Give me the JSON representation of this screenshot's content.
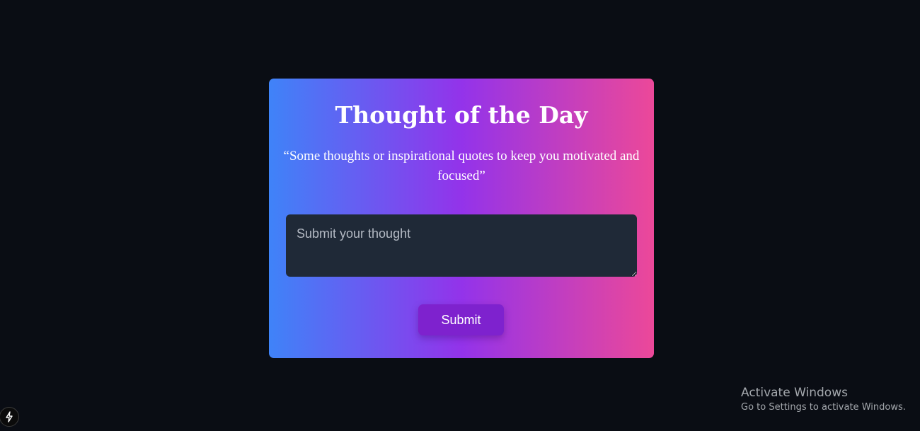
{
  "card": {
    "title": "Thought of the Day",
    "quote": "“Some thoughts or inspirational quotes to keep you motivated and focused”",
    "input": {
      "placeholder": "Submit your thought",
      "value": ""
    },
    "submit_label": "Submit"
  },
  "watermark": {
    "title": "Activate Windows",
    "subtitle": "Go to Settings to activate Windows."
  },
  "dev_badge": {
    "icon": "lightning-icon"
  },
  "colors": {
    "background": "#0a0d14",
    "gradient_start": "#3f83f8",
    "gradient_mid": "#9333ea",
    "gradient_end": "#ec4899",
    "input_background": "#1f2937",
    "button_background": "#7e22ce"
  }
}
